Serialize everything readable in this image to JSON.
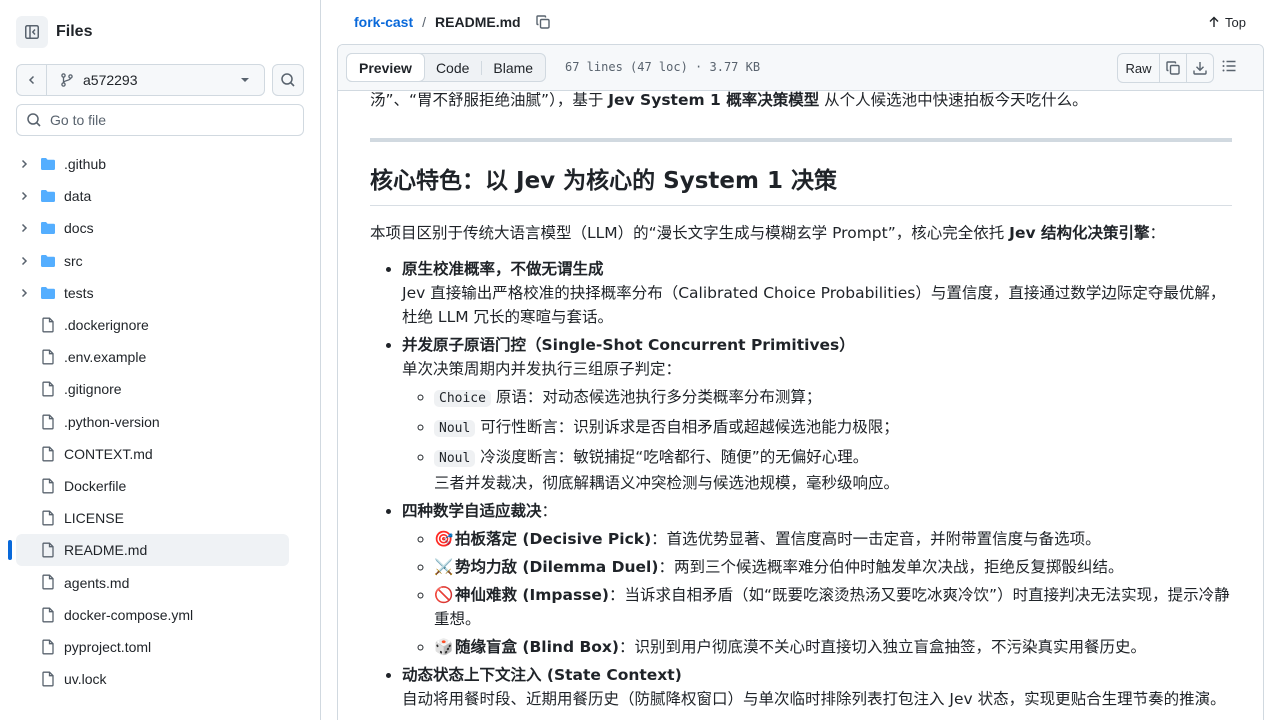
{
  "sidebar": {
    "title": "Files",
    "branch": "a572293",
    "goto_placeholder": "Go to file",
    "items": [
      {
        "type": "folder",
        "name": ".github"
      },
      {
        "type": "folder",
        "name": "data"
      },
      {
        "type": "folder",
        "name": "docs"
      },
      {
        "type": "folder",
        "name": "src"
      },
      {
        "type": "folder",
        "name": "tests"
      },
      {
        "type": "file",
        "name": ".dockerignore"
      },
      {
        "type": "file",
        "name": ".env.example"
      },
      {
        "type": "file",
        "name": ".gitignore"
      },
      {
        "type": "file",
        "name": ".python-version"
      },
      {
        "type": "file",
        "name": "CONTEXT.md"
      },
      {
        "type": "file",
        "name": "Dockerfile"
      },
      {
        "type": "file",
        "name": "LICENSE"
      },
      {
        "type": "file",
        "name": "README.md",
        "active": true
      },
      {
        "type": "file",
        "name": "agents.md"
      },
      {
        "type": "file",
        "name": "docker-compose.yml"
      },
      {
        "type": "file",
        "name": "pyproject.toml"
      },
      {
        "type": "file",
        "name": "uv.lock"
      }
    ]
  },
  "breadcrumb": {
    "repo": "fork-cast",
    "separator": "/",
    "file": "README.md",
    "top_label": "Top"
  },
  "file_header": {
    "tabs": [
      "Preview",
      "Code",
      "Blame"
    ],
    "meta": "67 lines (47 loc) · 3.77 KB",
    "raw_label": "Raw"
  },
  "readme": {
    "intro_a": "汤”、“胃不舒服拒绝油腻”），基于 ",
    "intro_b": "Jev System 1 概率决策模型",
    "intro_c": " 从个人候选池中快速拍板今天吃什么。",
    "heading": "核心特色：以 Jev 为核心的 System 1 决策",
    "para_a": "本项目区别于传统大语言模型（LLM）的“漫长文字生成与模糊玄学 Prompt”，核心完全依托 ",
    "para_b": "Jev 结构化决策引擎",
    "para_c": "：",
    "f1_title": "原生校准概率，不做无谓生成",
    "f1_body": "Jev 直接输出严格校准的抉择概率分布（Calibrated Choice Probabilities）与置信度，直接通过数学边际定夺最优解，杜绝 LLM 冗长的寒暄与套话。",
    "f2_title": "并发原子原语门控（Single-Shot Concurrent Primitives）",
    "f2_body": "单次决策周期内并发执行三组原子判定：",
    "f2_items": [
      {
        "code": "Choice",
        "text": " 原语：对动态候选池执行多分类概率分布测算；"
      },
      {
        "code": "Noul",
        "text": " 可行性断言：识别诉求是否自相矛盾或超越候选池能力极限；"
      },
      {
        "code": "Noul",
        "text": " 冷淡度断言：敏锐捕捉“吃啥都行、随便”的无偏好心理。"
      }
    ],
    "f2_tail": "三者并发裁决，彻底解耦语义冲突检测与候选池规模，毫秒级响应。",
    "f3_title": "四种数学自适应裁决",
    "f3_colon": "：",
    "f3_items": [
      {
        "emoji": "🎯",
        "title": "拍板落定 (Decisive Pick)",
        "text": "：首选优势显著、置信度高时一击定音，并附带置信度与备选项。"
      },
      {
        "emoji": "⚔️",
        "title": "势均力敌 (Dilemma Duel)",
        "text": "：两到三个候选概率难分伯仲时触发单次决战，拒绝反复掷骰纠结。"
      },
      {
        "emoji": "🚫",
        "title": "神仙难救 (Impasse)",
        "text": "：当诉求自相矛盾（如“既要吃滚烫热汤又要吃冰爽冷饮”）时直接判决无法实现，提示冷静重想。"
      },
      {
        "emoji": "🎲",
        "title": "随缘盲盒 (Blind Box)",
        "text": "：识别到用户彻底漠不关心时直接切入独立盲盒抽签，不污染真实用餐历史。"
      }
    ],
    "f4_title": "动态状态上下文注入 (State Context)",
    "f4_body": "自动将用餐时段、近期用餐历史（防腻降权窗口）与单次临时排除列表打包注入 Jev 状态，实现更贴合生理节奏的推演。"
  }
}
